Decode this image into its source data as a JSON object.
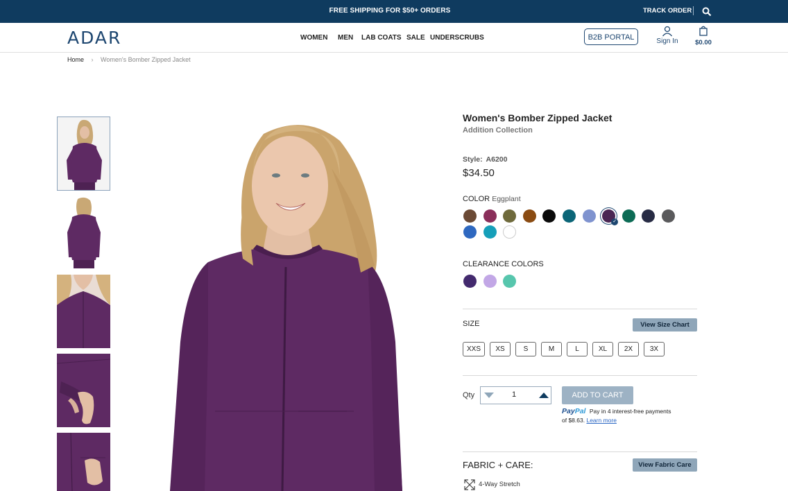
{
  "topbar": {
    "shipping": "FREE SHIPPING FOR $50+ ORDERS",
    "track": "TRACK ORDER"
  },
  "header": {
    "logo": "ADAR",
    "nav": [
      "WOMEN",
      "MEN",
      "LAB COATS",
      "SALE",
      "UNDERSCRUBS"
    ],
    "b2b": "B2B PORTAL",
    "signin": "Sign In",
    "cart_total": "$0.00"
  },
  "breadcrumb": {
    "home": "Home",
    "sep": "›",
    "current": "Women's Bomber Zipped Jacket"
  },
  "product": {
    "title": "Women's Bomber Zipped Jacket",
    "collection": "Addition Collection",
    "style_label": "Style:",
    "style_value": "A6200",
    "price": "$34.50",
    "color_label": "COLOR",
    "color_value": "Eggplant",
    "colors": [
      "#6b4a35",
      "#8a2f5a",
      "#6f6a3c",
      "#8a4b12",
      "#0a0a0a",
      "#0b6577",
      "#7f93cf",
      "#4a2653",
      "#0c6b55",
      "#272b44",
      "#5a5a5c",
      "#2e68c0",
      "#169fb9",
      "#ffffff"
    ],
    "selected_color_index": 7,
    "clearance_label": "CLEARANCE COLORS",
    "clearance_colors": [
      "#432a6e",
      "#c2a7e6",
      "#57c6ad"
    ],
    "size_label": "SIZE",
    "size_chart": "View Size Chart",
    "sizes": [
      "XXS",
      "XS",
      "S",
      "M",
      "L",
      "XL",
      "2X",
      "3X"
    ],
    "qty_label": "Qty",
    "qty": "1",
    "add_to_cart": "ADD TO CART",
    "paypal_brand_1": "Pay",
    "paypal_brand_2": "Pal",
    "paypal_text": "Pay in 4 interest-free payments",
    "paypal_amount": "of $8.63.",
    "paypal_learn": "Learn more",
    "fabric_label": "FABRIC + CARE:",
    "fabric_btn": "View Fabric Care",
    "feature": "4-Way Stretch"
  },
  "colors": {
    "brand": "#0f3b5f",
    "jacket": "#5e2a63"
  }
}
